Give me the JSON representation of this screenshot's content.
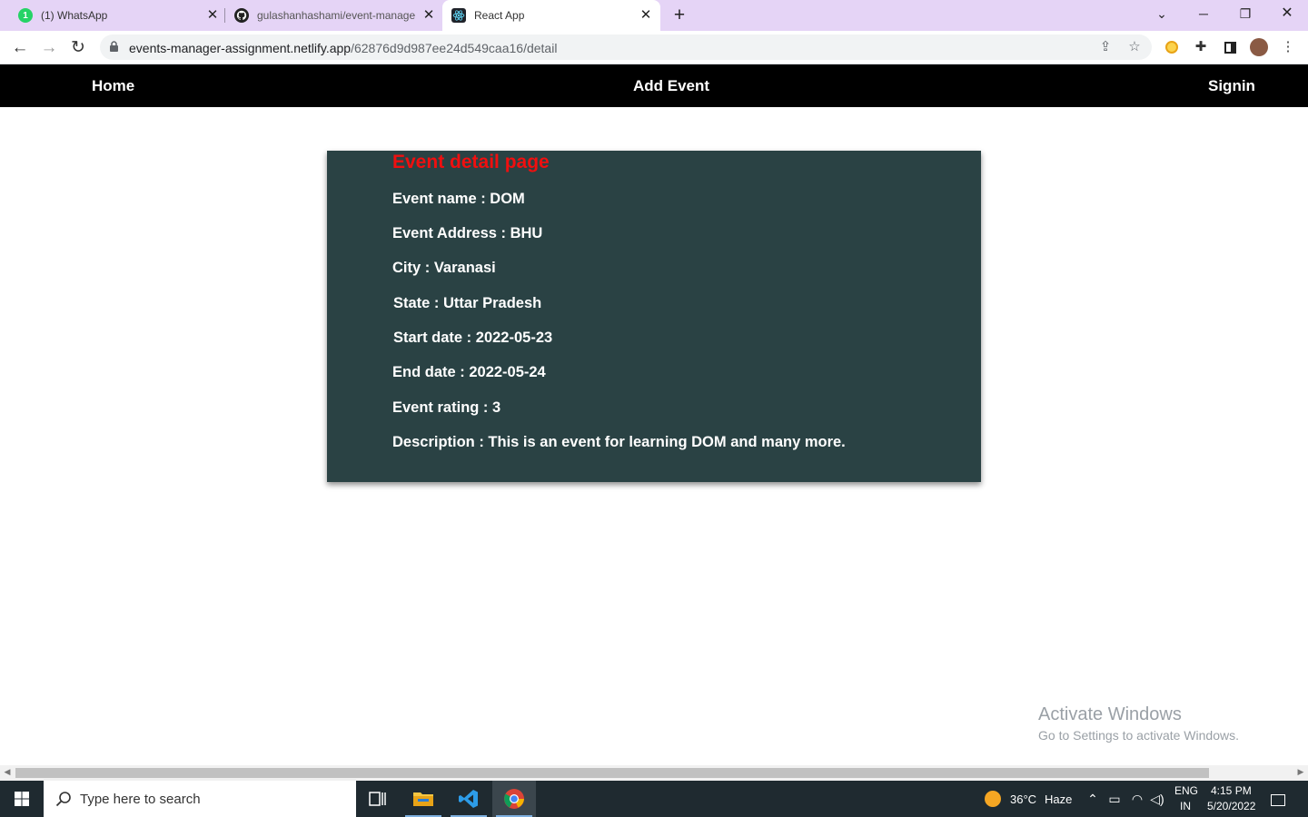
{
  "browser": {
    "tabs": [
      {
        "title": "(1) WhatsApp",
        "favicon": "whatsapp-icon",
        "badge": "1",
        "active": false
      },
      {
        "title": "gulashanhashami/event-manage",
        "favicon": "github-icon",
        "active": false
      },
      {
        "title": "React App",
        "favicon": "react-icon",
        "active": true
      }
    ],
    "url_host": "events-manager-assignment.netlify.app",
    "url_path": "/62876d9d987ee24d549caa16/detail",
    "colors": {
      "tabstrip": "#e5d4f6",
      "omnibox": "#f1f3f4"
    }
  },
  "app": {
    "nav": {
      "home": "Home",
      "add_event": "Add Event",
      "signin": "Signin"
    },
    "card": {
      "heading": "Event detail page",
      "fields": {
        "name": "Event name : DOM",
        "address": "Event Address : BHU",
        "city": "City : Varanasi",
        "state": "State : Uttar Pradesh",
        "start_date": "Start date : 2022-05-23",
        "end_date": "End date : 2022-05-24",
        "rating": "Event rating : 3",
        "description": "Description : This is an event for learning DOM and many more."
      }
    },
    "colors": {
      "nav_bg": "#000000",
      "card_bg": "#2a4244",
      "heading": "#f00f0f",
      "text": "#ffffff"
    }
  },
  "watermark": {
    "line1": "Activate Windows",
    "line2": "Go to Settings to activate Windows."
  },
  "taskbar": {
    "search_placeholder": "Type here to search",
    "weather_temp": "36°C",
    "weather_desc": "Haze",
    "lang_top": "ENG",
    "lang_bottom": "IN",
    "time": "4:15 PM",
    "date": "5/20/2022"
  }
}
